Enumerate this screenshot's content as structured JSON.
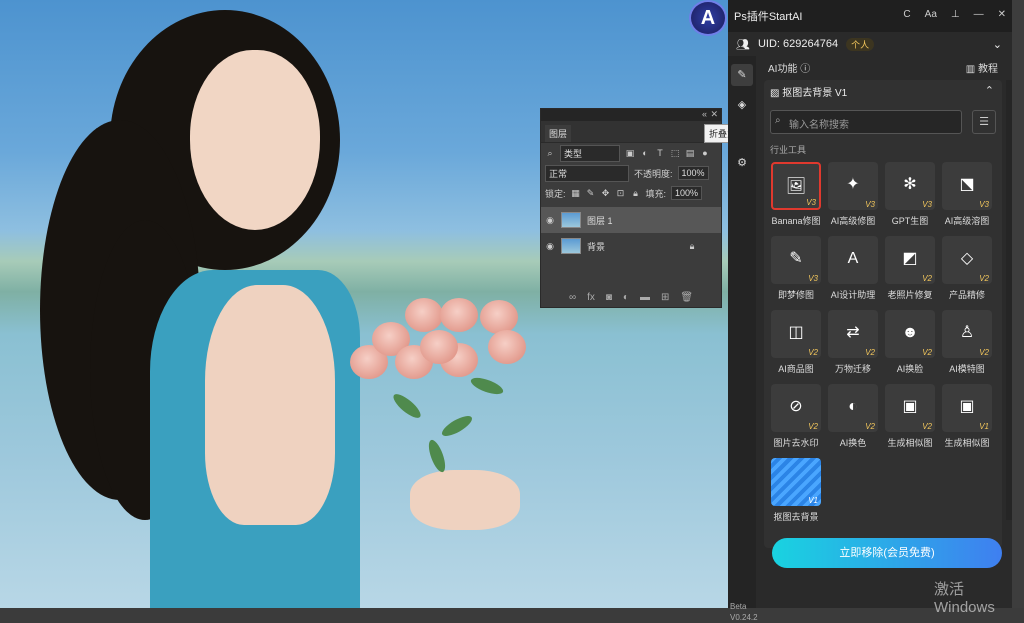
{
  "layers_panel": {
    "tab": "图层",
    "filter_kind": "类型",
    "blend_mode": "正常",
    "opacity_label": "不透明度:",
    "opacity_value": "100%",
    "lock_label": "锁定:",
    "fill_label": "填充:",
    "fill_value": "100%",
    "layers": [
      {
        "name": "图层 1",
        "active": true
      },
      {
        "name": "背景",
        "active": false
      }
    ],
    "tooltip": "折叠为图标"
  },
  "plugin": {
    "title": "Ps插件StartAI",
    "window_controls": [
      "C",
      "Aa",
      "⊥",
      "—",
      "✕"
    ],
    "uid_label": "UID: 629264764",
    "user_badge": "个人",
    "section_title": "AI功能",
    "tutorial_label": "教程",
    "card_title": "抠图去背景 V1",
    "search_placeholder": "输入名称搜索",
    "category_label": "行业工具",
    "tools": [
      {
        "name": "Banana修图",
        "version": "V3",
        "icon": "image-edit-icon",
        "highlight": true
      },
      {
        "name": "AI高级修图",
        "version": "V3",
        "icon": "magic-wand-icon"
      },
      {
        "name": "GPT生图",
        "version": "V3",
        "icon": "gpt-icon"
      },
      {
        "name": "AI高级溶图",
        "version": "V3",
        "icon": "image-blend-icon"
      },
      {
        "name": "即梦修图",
        "version": "V3",
        "icon": "brush-edit-icon"
      },
      {
        "name": "AI设计助理",
        "version": "",
        "icon": "design-assistant-icon"
      },
      {
        "name": "老照片修复",
        "version": "V2",
        "icon": "photo-restore-icon"
      },
      {
        "name": "产品精修",
        "version": "V2",
        "icon": "diamond-icon"
      },
      {
        "name": "AI商品图",
        "version": "V2",
        "icon": "product-bag-icon"
      },
      {
        "name": "万物迁移",
        "version": "V2",
        "icon": "transfer-icon"
      },
      {
        "name": "AI换脸",
        "version": "V2",
        "icon": "face-swap-icon"
      },
      {
        "name": "AI模特图",
        "version": "V2",
        "icon": "model-icon"
      },
      {
        "name": "图片去水印",
        "version": "V2",
        "icon": "watermark-remove-icon"
      },
      {
        "name": "AI换色",
        "version": "V2",
        "icon": "recolor-icon"
      },
      {
        "name": "生成相似图",
        "version": "V2",
        "icon": "similar-image-icon"
      },
      {
        "name": "生成相似图",
        "version": "V1",
        "icon": "similar-image-icon"
      },
      {
        "name": "抠图去背景",
        "version": "V1",
        "icon": "cutout-icon",
        "blue": true
      }
    ],
    "cta_label": "立即移除(会员免费)",
    "beta_label": "Beta",
    "version_label": "V0.24.2"
  },
  "os_watermark": "激活 Windows",
  "colors": {
    "accent": "#3f7ff0",
    "cta_start": "#19d3e0",
    "highlight": "#e0392e",
    "badge": "#f2c65c"
  }
}
